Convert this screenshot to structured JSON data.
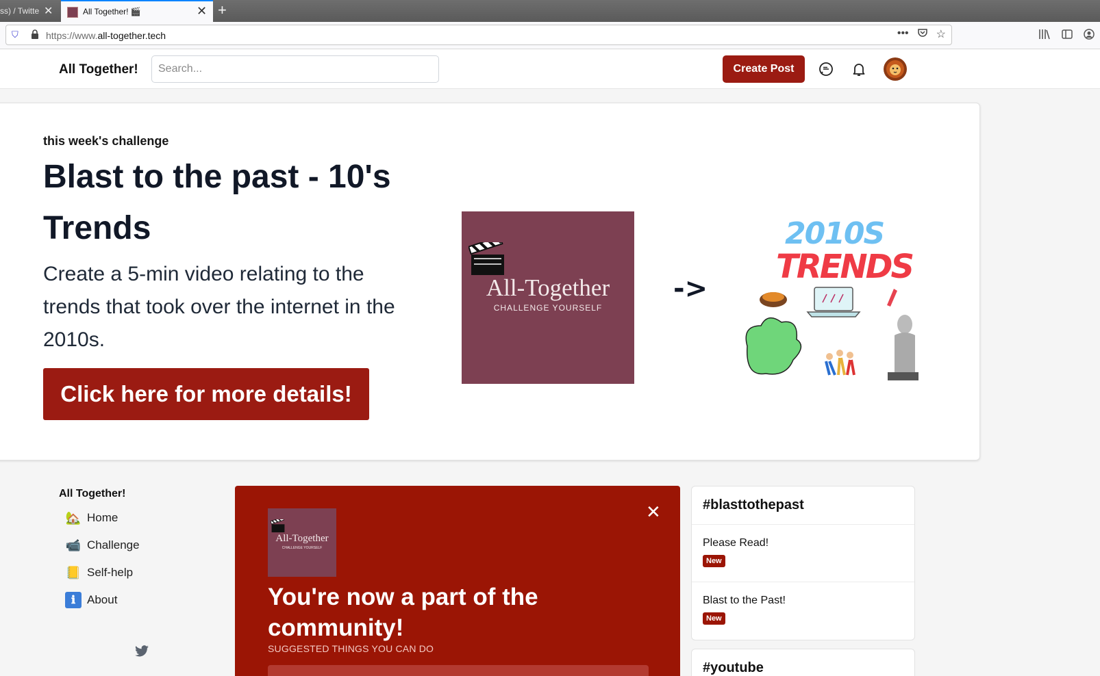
{
  "browser": {
    "prev_tab_title": "ss) / Twitte",
    "active_tab_title": "All Together! 🎬",
    "url_prefix": "https://www.",
    "url_domain": "all-together.tech"
  },
  "header": {
    "brand": "All Together!",
    "search_placeholder": "Search...",
    "create_post_label": "Create Post"
  },
  "hero": {
    "eyebrow": "this week's challenge",
    "title": "Blast to the past - 10's Trends",
    "description": "Create a 5-min video relating to the trends that took over the internet in the 2010s.",
    "cta_label": "Click here for more details!",
    "logo_name": "All-Together",
    "logo_tagline": "CHALLENGE YOURSELF",
    "arrow": "->",
    "trends_year": "2010S",
    "trends_word": "TRENDS"
  },
  "leftnav": {
    "heading": "All Together!",
    "items": [
      {
        "label": "Home",
        "icon": "🏡"
      },
      {
        "label": "Challenge",
        "icon": "📹"
      },
      {
        "label": "Self-help",
        "icon": "📒"
      },
      {
        "label": "About",
        "icon": "ℹ"
      }
    ]
  },
  "welcome": {
    "title": "You're now a part of the community!",
    "subtitle": "SUGGESTED THINGS YOU CAN DO",
    "thumb_name": "All-Together",
    "thumb_tagline": "CHALLENGE YOURSELF"
  },
  "rightbar": {
    "card1": {
      "tag": "#blasttothepast",
      "posts": [
        {
          "title": "Please Read!",
          "badge": "New"
        },
        {
          "title": "Blast to the Past!",
          "badge": "New"
        }
      ]
    },
    "card2": {
      "tag": "#youtube"
    }
  },
  "colors": {
    "brand_red": "#9b1b12",
    "logo_plum": "#7d4052",
    "trends_blue": "#6ec0f2",
    "trends_red": "#ef3b45"
  }
}
